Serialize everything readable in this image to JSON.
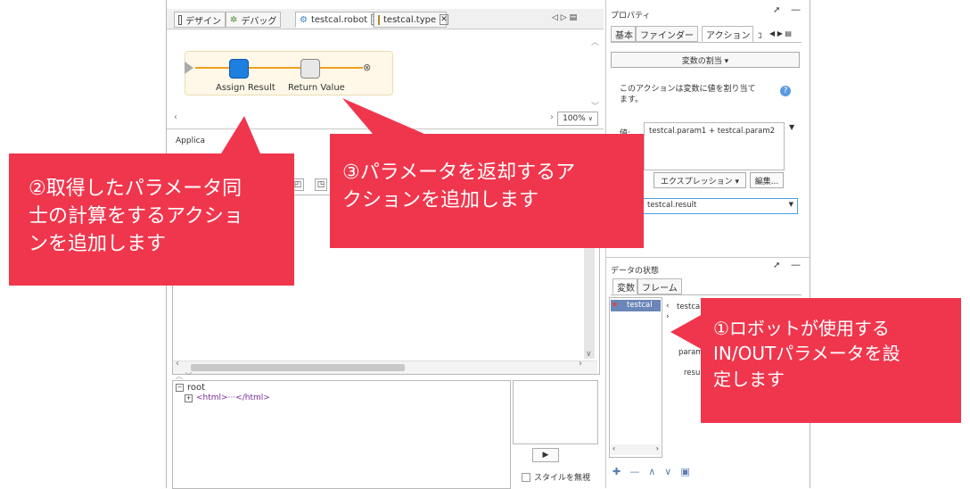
{
  "editor": {
    "tab_design": "デザイン",
    "tab_debug": "デバッグ",
    "tab_robot": "testcal.robot",
    "tab_type": "testcal.type",
    "nav_icons": "◁ ▷ ▤",
    "node1_label": "Assign Result",
    "node2_label": "Return Value",
    "zoom": "100%",
    "section_label": "Applica",
    "tree_root": "root",
    "tree_child": "<html>···</html>",
    "ignore_style": "スタイルを無視"
  },
  "properties": {
    "title": "プロパティ",
    "tabs": [
      "基本",
      "ファインダー",
      "アクション",
      "ｺ"
    ],
    "action_dropdown": "変数の割当 ▾",
    "description": "このアクションは変数に値を割り当てます。",
    "value_label": "値:",
    "value_text": "testcal.param1 + testcal.param2",
    "expression_button": "エクスプレッション ▾",
    "edit_button": "編集...",
    "target_variable": "testcal.result"
  },
  "data_state": {
    "title": "データの状態",
    "tabs": [
      "変数",
      "フレーム"
    ],
    "selected_variable": "testcal",
    "detail_header": "testcal",
    "detail_rows": [
      "par",
      "param",
      "resu"
    ]
  },
  "callouts": {
    "c1_lines": [
      "①ロボットが使用する",
      "IN/OUTパラメータを設",
      "定します"
    ],
    "c2_lines": [
      "②取得したパラメータ同",
      "士の計算をするアクショ",
      "ンを追加します"
    ],
    "c3_lines": [
      "③パラメータを返却するア",
      "クションを追加します"
    ]
  },
  "colors": {
    "callout": "#f0364d",
    "node_blue": "#1f7fe0",
    "flow_orange": "#f0a020",
    "tab_active": "#ffffff"
  }
}
